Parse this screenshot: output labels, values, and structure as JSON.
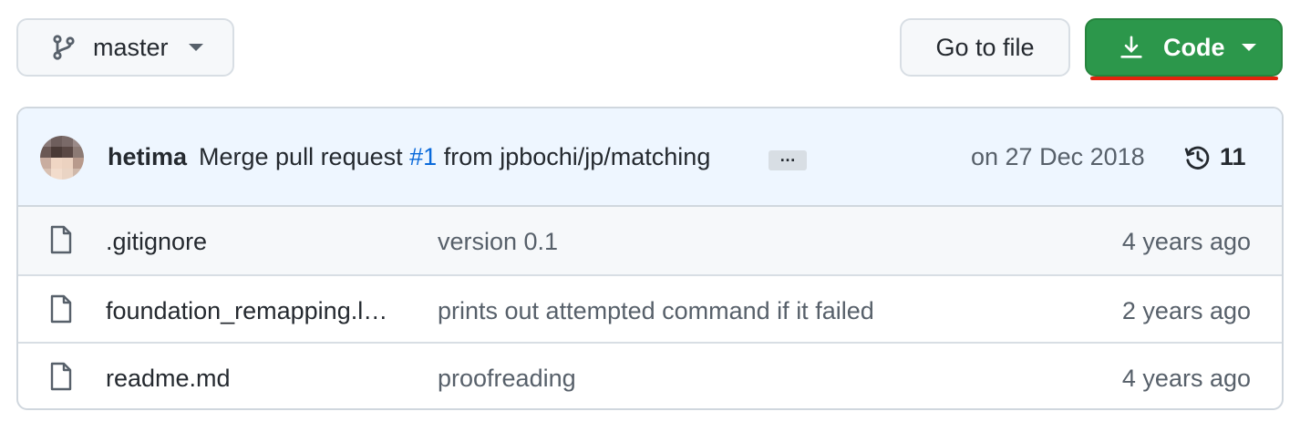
{
  "toolbar": {
    "branch_label": "master",
    "go_to_file_label": "Go to file",
    "code_label": "Code"
  },
  "commit": {
    "author": "hetima",
    "message_prefix": "Merge pull request",
    "pr_number": "#1",
    "message_suffix": "from jpbochi/jp/matching",
    "ellipsis": "…",
    "date": "on 27 Dec 2018",
    "history_count": "11"
  },
  "files": [
    {
      "name": ".gitignore",
      "message": "version 0.1",
      "age": "4 years ago"
    },
    {
      "name": "foundation_remapping.l…",
      "message": "prints out attempted command if it failed",
      "age": "2 years ago"
    },
    {
      "name": "readme.md",
      "message": "proofreading",
      "age": "4 years ago"
    }
  ],
  "icons": {
    "branch": "git-branch-icon",
    "download": "download-icon",
    "history": "history-icon",
    "file": "file-icon"
  },
  "colors": {
    "code_button": "#2c974b",
    "link": "#0969da",
    "commit_bar": "#eef6ff",
    "highlight_underline": "#e3240d"
  }
}
